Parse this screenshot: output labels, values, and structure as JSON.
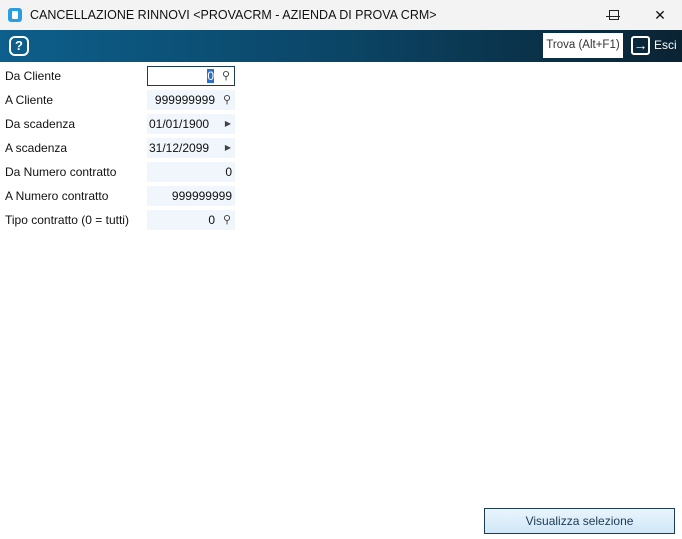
{
  "window": {
    "title": "CANCELLAZIONE RINNOVI <PROVACRM - AZIENDA DI PROVA CRM>"
  },
  "toolbar": {
    "find_label": "Trova (Alt+F1)",
    "exit_label": "Esci"
  },
  "form": {
    "fields": [
      {
        "label": "Da Cliente",
        "value": "0"
      },
      {
        "label": "A Cliente",
        "value": "999999999"
      },
      {
        "label": "Da scadenza",
        "value": "01/01/1900"
      },
      {
        "label": "A scadenza",
        "value": "31/12/2099"
      },
      {
        "label": "Da Numero contratto",
        "value": "0"
      },
      {
        "label": "A Numero contratto",
        "value": "999999999"
      },
      {
        "label": "Tipo contratto (0 = tutti)",
        "value": "0"
      }
    ]
  },
  "actions": {
    "show_selection": "Visualizza selezione"
  }
}
